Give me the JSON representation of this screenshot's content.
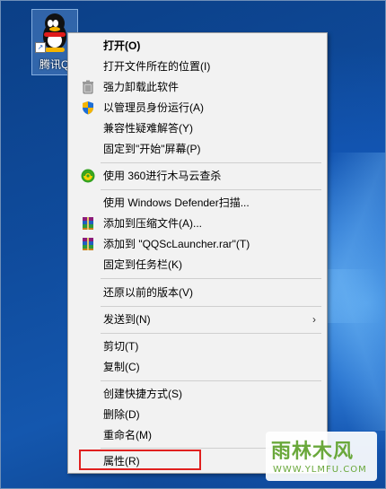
{
  "desktop": {
    "icon_label": "腾讯QQ",
    "icon_name": "qq-penguin-icon"
  },
  "context_menu": {
    "items": [
      {
        "label": "打开(O)",
        "icon": null
      },
      {
        "label": "打开文件所在的位置(I)",
        "icon": null
      },
      {
        "label": "强力卸载此软件",
        "icon": "trash-icon"
      },
      {
        "label": "以管理员身份运行(A)",
        "icon": "uac-shield-icon"
      },
      {
        "label": "兼容性疑难解答(Y)",
        "icon": null
      },
      {
        "label": "固定到\"开始\"屏幕(P)",
        "icon": null
      },
      {
        "label": "使用 360进行木马云查杀",
        "icon": "360-icon"
      },
      {
        "label": "使用 Windows Defender扫描...",
        "icon": null
      },
      {
        "label": "添加到压缩文件(A)...",
        "icon": "winrar-icon"
      },
      {
        "label": "添加到 \"QQScLauncher.rar\"(T)",
        "icon": "winrar-icon"
      },
      {
        "label": "固定到任务栏(K)",
        "icon": null
      },
      {
        "label": "还原以前的版本(V)",
        "icon": null
      },
      {
        "label": "发送到(N)",
        "icon": null,
        "submenu": true
      },
      {
        "label": "剪切(T)",
        "icon": null
      },
      {
        "label": "复制(C)",
        "icon": null
      },
      {
        "label": "创建快捷方式(S)",
        "icon": null
      },
      {
        "label": "删除(D)",
        "icon": null
      },
      {
        "label": "重命名(M)",
        "icon": null
      },
      {
        "label": "属性(R)",
        "icon": null,
        "highlighted": true
      }
    ],
    "submenu_arrow": "›",
    "highlight_color": "#e0201f"
  },
  "watermark": {
    "title": "雨林木风",
    "url": "WWW.YLMFU.COM"
  }
}
